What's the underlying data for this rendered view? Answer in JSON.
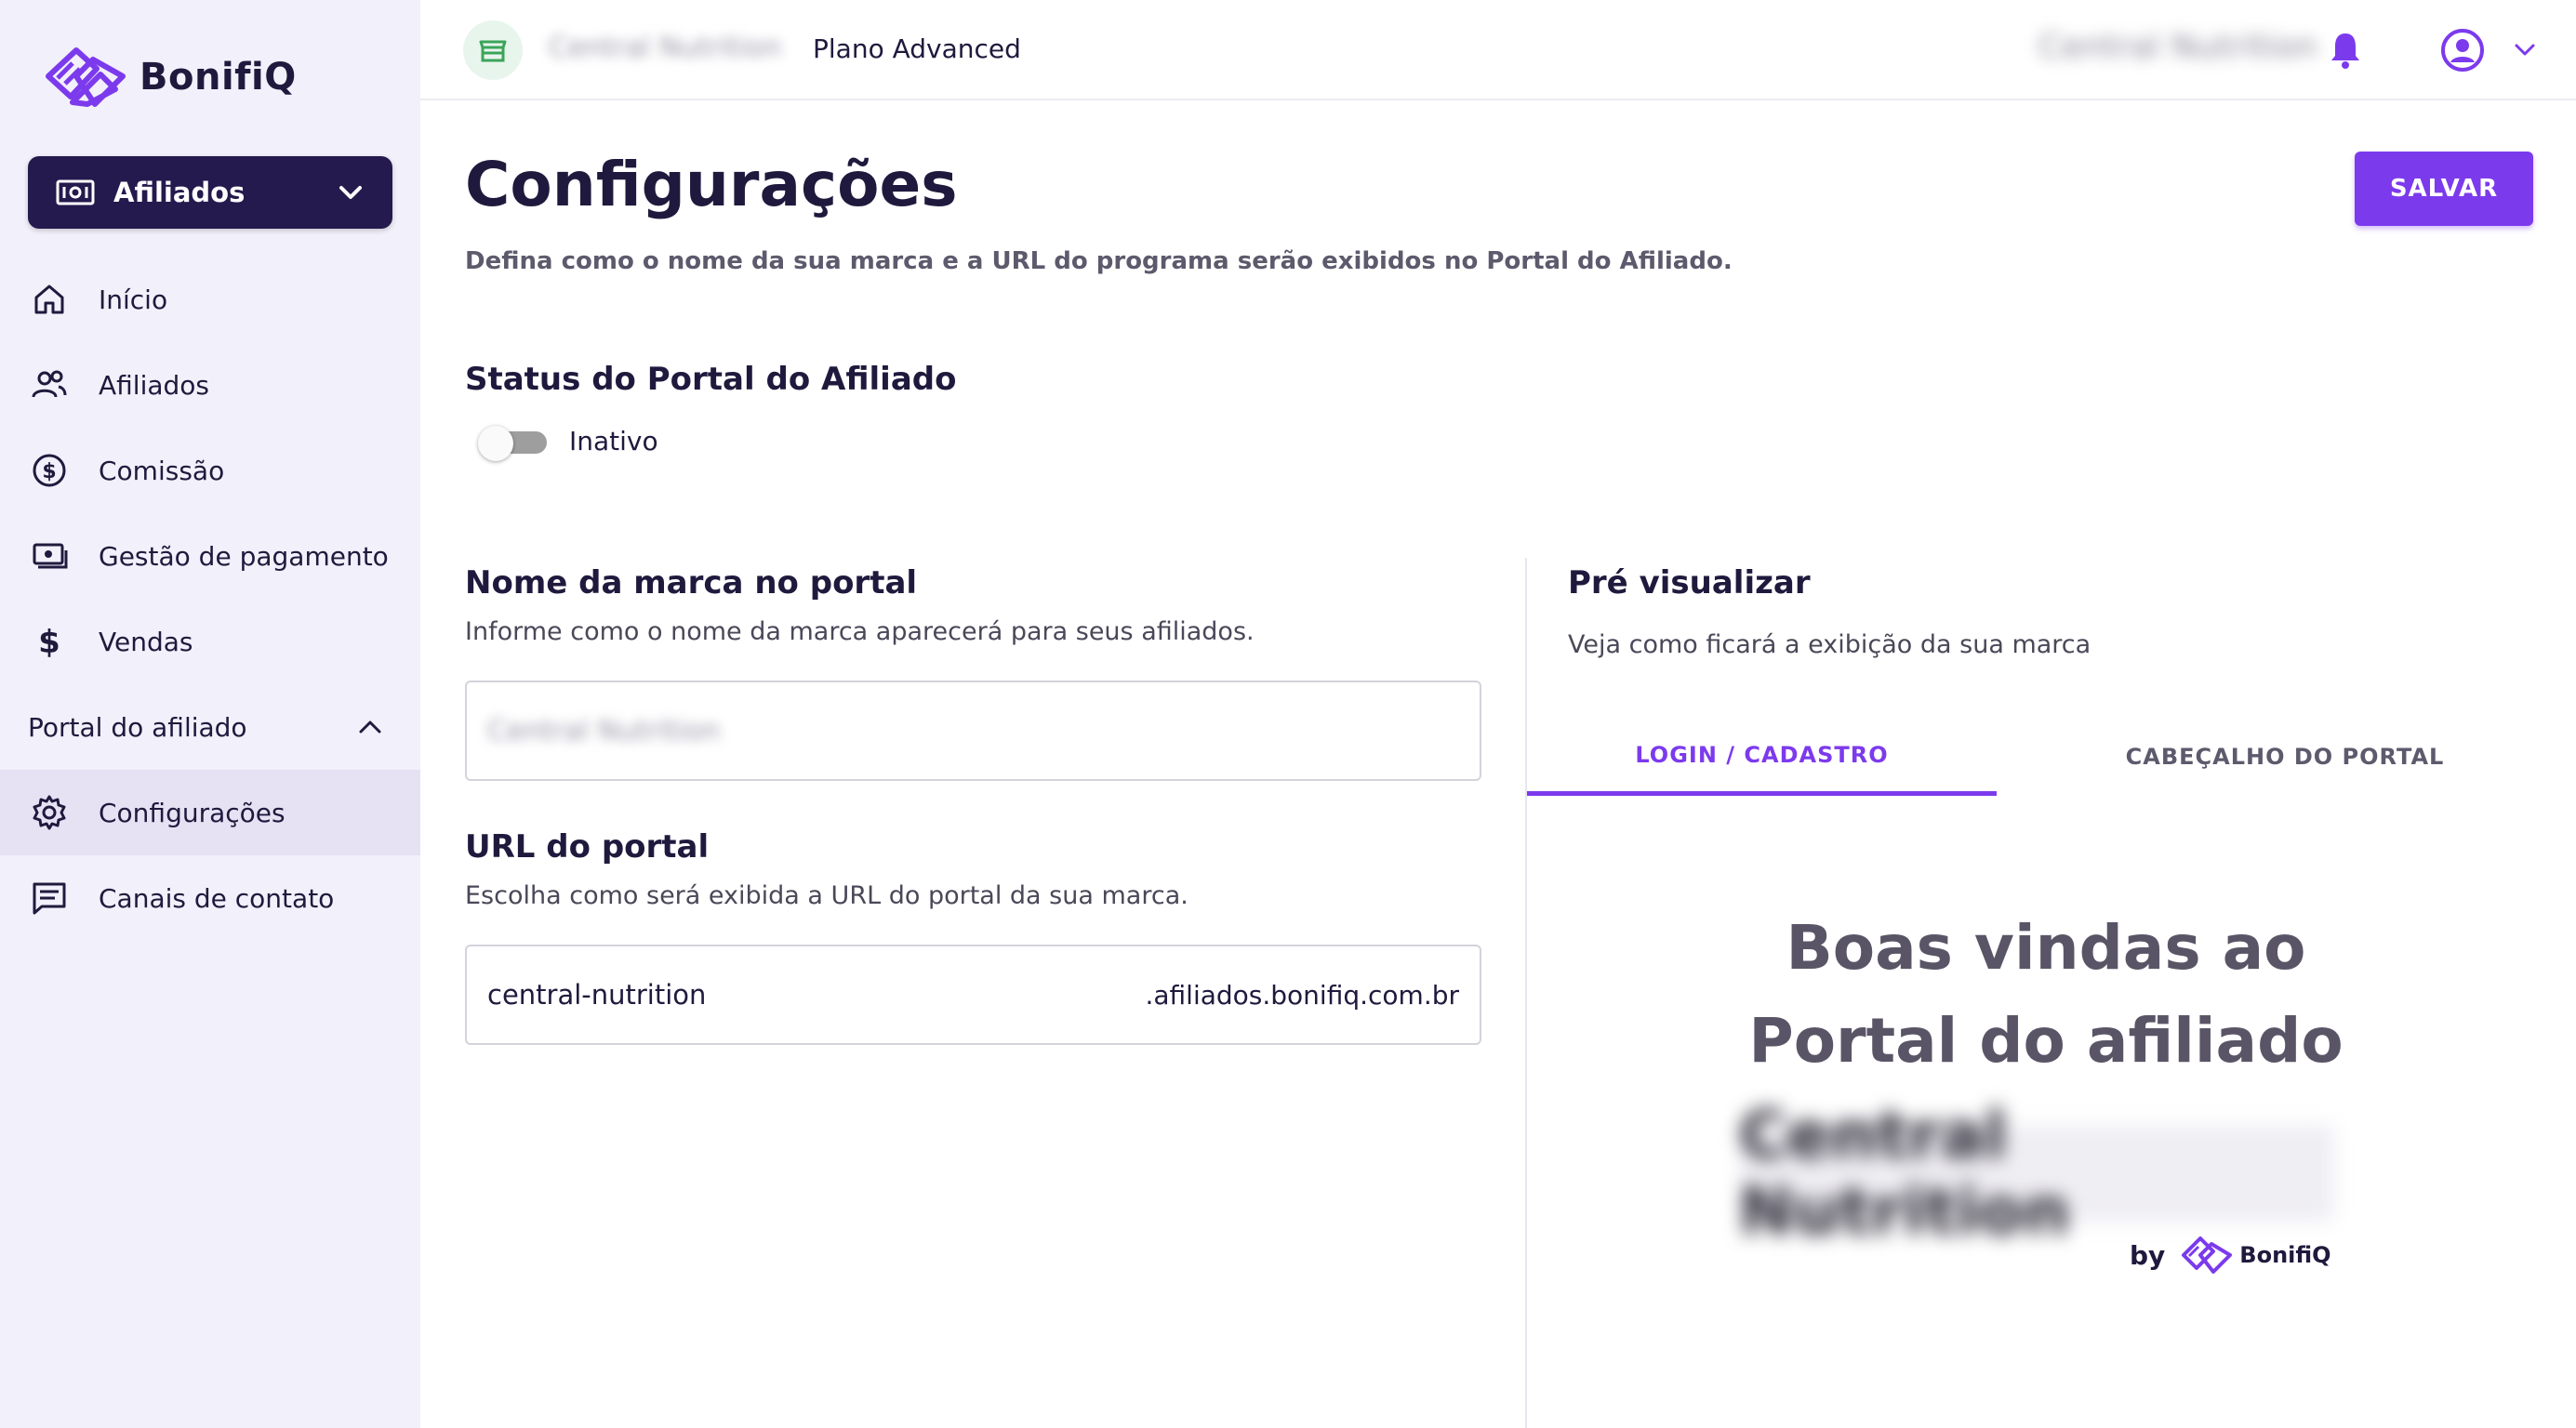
{
  "brand": {
    "name": "BonifiQ"
  },
  "sidebar": {
    "program_select": "Afiliados",
    "items": [
      {
        "label": "Início",
        "icon": "home-icon"
      },
      {
        "label": "Afiliados",
        "icon": "users-icon"
      },
      {
        "label": "Comissão",
        "icon": "dollar-circle-icon"
      },
      {
        "label": "Gestão de pagamento",
        "icon": "payment-icon"
      },
      {
        "label": "Vendas",
        "icon": "dollar-icon"
      }
    ],
    "group": {
      "label": "Portal do afiliado",
      "expanded": true
    },
    "sub_items": [
      {
        "label": "Configurações",
        "icon": "gear-icon",
        "active": true
      },
      {
        "label": "Canais de contato",
        "icon": "message-icon"
      }
    ]
  },
  "topbar": {
    "store_name": "Central Nutrition",
    "plan": "Plano Advanced",
    "user_name": "Central Nutrition"
  },
  "page": {
    "title": "Configurações",
    "subtitle": "Defina como o nome da sua marca e a URL do programa serão exibidos no Portal do Afiliado.",
    "save_label": "SALVAR"
  },
  "status": {
    "title": "Status do Portal do Afiliado",
    "toggle_on": false,
    "toggle_label": "Inativo"
  },
  "brand_name_section": {
    "title": "Nome da marca no portal",
    "desc": "Informe como o nome da marca aparecerá para seus afiliados.",
    "value": "Central Nutrition"
  },
  "url_section": {
    "title": "URL do portal",
    "desc": "Escolha como será exibida a URL do portal da sua marca.",
    "value": "central-nutrition",
    "suffix": ".afiliados.bonifiq.com.br"
  },
  "preview": {
    "title": "Pré visualizar",
    "desc": "Veja como ficará a exibição da sua marca",
    "tabs": [
      "LOGIN / CADASTRO",
      "CABEÇALHO DO PORTAL"
    ],
    "active_tab": 0,
    "welcome_line1": "Boas vindas ao",
    "welcome_line2": "Portal do afiliado",
    "brand_name": "Central Nutrition",
    "by_label": "by",
    "by_brand": "BonifiQ"
  },
  "colors": {
    "accent": "#7c3aed",
    "sidebar_bg": "#f2f0fa",
    "program_select_bg": "#241a4d",
    "text_primary": "#1f1a3d"
  }
}
